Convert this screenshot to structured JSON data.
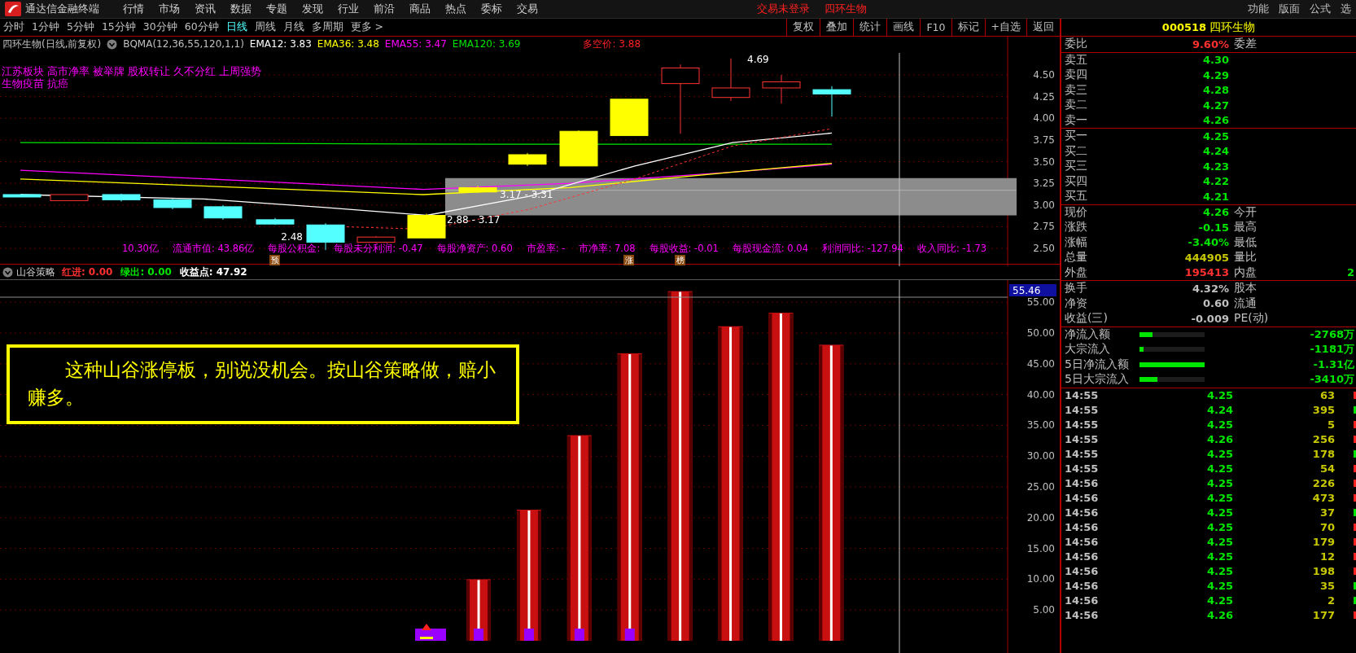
{
  "menu_bar": {
    "app_name": "通达信金融终端",
    "items": [
      "行情",
      "市场",
      "资讯",
      "数据",
      "专题",
      "发现",
      "行业",
      "前沿",
      "商品",
      "热点",
      "委标",
      "交易"
    ],
    "status": [
      "交易未登录",
      "四环生物"
    ],
    "right_items": [
      "功能",
      "版面",
      "公式",
      "选"
    ]
  },
  "period_tabs": [
    {
      "label": "分时",
      "selected": false
    },
    {
      "label": "1分钟",
      "selected": false
    },
    {
      "label": "5分钟",
      "selected": false
    },
    {
      "label": "15分钟",
      "selected": false
    },
    {
      "label": "30分钟",
      "selected": false
    },
    {
      "label": "60分钟",
      "selected": false
    },
    {
      "label": "日线",
      "selected": true
    },
    {
      "label": "周线",
      "selected": false
    },
    {
      "label": "月线",
      "selected": false
    },
    {
      "label": "多周期",
      "selected": false
    },
    {
      "label": "更多 >",
      "selected": false
    }
  ],
  "toolbar_buttons": [
    "复权",
    "叠加",
    "统计",
    "画线",
    "F10",
    "标记",
    "+自选",
    "返回"
  ],
  "price_chart": {
    "title": "四环生物(日线,前复权)",
    "indicator": "BQMA(12,36,55,120,1,1)",
    "lines": [
      {
        "label": "EMA12: 3.83",
        "color": "#ffffff"
      },
      {
        "label": "EMA36: 3.48",
        "color": "#ffff00"
      },
      {
        "label": "EMA55: 3.47",
        "color": "#ff00ff"
      },
      {
        "label": "EMA120: 3.69",
        "color": "#00e600"
      }
    ],
    "bull_bear": "多空价: 3.88",
    "concepts": [
      "江苏板块 高市净率 被举牌 股权转让 久不分红 上周强势",
      "生物疫苗 抗癌"
    ],
    "annotations": [
      "4.69",
      "3.17 - 3.31",
      "2.88 - 3.17",
      "2.48"
    ],
    "price_axis": [
      "4.50",
      "4.25",
      "4.00",
      "3.75",
      "3.50",
      "3.25",
      "3.00",
      "2.75",
      "2.50"
    ],
    "fundamentals": [
      "10.30亿",
      "流通市值: 43.86亿",
      "每股公积金:",
      "每股未分利润: -0.47",
      "每股净资产: 0.60",
      "市盈率: -",
      "市净率: 7.08",
      "每股收益: -0.01",
      "每股现金流: 0.04",
      "利润同比: -127.94",
      "收入同比: -1.73"
    ],
    "badges": [
      "预",
      "涨",
      "榜"
    ]
  },
  "strategy_panel": {
    "title": "山谷策略",
    "readouts": [
      {
        "label": "红进:",
        "value": "0.00",
        "color": "#ff3030"
      },
      {
        "label": "绿出:",
        "value": "0.00",
        "color": "#00e600"
      },
      {
        "label": "收益点:",
        "value": "47.92",
        "color": "#ffffff"
      }
    ],
    "note": "这种山谷涨停板，别说没机会。按山谷策略做，赔小赚多。",
    "max_label": "55.46",
    "chart_data": {
      "type": "bar",
      "grid": true,
      "values": [
        null,
        null,
        null,
        null,
        null,
        null,
        null,
        null,
        null,
        10.0,
        21.3,
        33.4,
        46.7,
        56.8,
        51.1,
        53.3,
        48.1,
        null,
        null,
        null
      ],
      "ylim": [
        0,
        58.6
      ],
      "yticks": [
        {
          "value": 5,
          "label": "5.00"
        },
        {
          "value": 10,
          "label": "10.00"
        },
        {
          "value": 15,
          "label": "15.00"
        },
        {
          "value": 20,
          "label": "20.00"
        },
        {
          "value": 25,
          "label": "25.00"
        },
        {
          "value": 30,
          "label": "30.00"
        },
        {
          "value": 35,
          "label": "35.00"
        },
        {
          "value": 40,
          "label": "40.00"
        },
        {
          "value": 45,
          "label": "45.00"
        },
        {
          "value": 50,
          "label": "50.00"
        },
        {
          "value": 55,
          "label": "55.00"
        }
      ]
    }
  },
  "stock_header": {
    "code": "000518",
    "name": "四环生物"
  },
  "order_ratio": {
    "label": "委比",
    "value": "9.60%",
    "label2": "委差"
  },
  "asks": [
    {
      "label": "卖五",
      "price": "4.30"
    },
    {
      "label": "卖四",
      "price": "4.29"
    },
    {
      "label": "卖三",
      "price": "4.28"
    },
    {
      "label": "卖二",
      "price": "4.27"
    },
    {
      "label": "卖一",
      "price": "4.26"
    }
  ],
  "bids": [
    {
      "label": "买一",
      "price": "4.25"
    },
    {
      "label": "买二",
      "price": "4.24"
    },
    {
      "label": "买三",
      "price": "4.23"
    },
    {
      "label": "买四",
      "price": "4.22"
    },
    {
      "label": "买五",
      "price": "4.21"
    }
  ],
  "quote": [
    {
      "label": "现价",
      "value": "4.26",
      "label2": "今开",
      "color": "#00e600"
    },
    {
      "label": "涨跌",
      "value": "-0.15",
      "label2": "最高",
      "color": "#00e600"
    },
    {
      "label": "涨幅",
      "value": "-3.40%",
      "label2": "最低",
      "color": "#00e600"
    },
    {
      "label": "总量",
      "value": "444905",
      "label2": "量比",
      "color": "#c8c800"
    },
    {
      "label": "外盘",
      "value": "195413",
      "label2": "内盘",
      "value2": "2",
      "color": "#ff3030"
    }
  ],
  "stats": [
    {
      "label": "换手",
      "value": "4.32%",
      "label2": "股本"
    },
    {
      "label": "净资",
      "value": "0.60",
      "label2": "流通"
    },
    {
      "label": "收益(三)",
      "value": "-0.009",
      "label2": "PE(动)"
    }
  ],
  "fund_flows": [
    {
      "label": "净流入额",
      "level": 0.2,
      "value": "-2768万"
    },
    {
      "label": "大宗流入",
      "level": 0.06,
      "value": "-1181万"
    },
    {
      "label": "5日净流入额",
      "level": 1.0,
      "value": "-1.31亿"
    },
    {
      "label": "5日大宗流入",
      "level": 0.27,
      "value": "-3410万"
    }
  ],
  "ticks": [
    {
      "time": "14:55",
      "price": "4.25",
      "volume": "63",
      "color": "#ff2020"
    },
    {
      "time": "14:55",
      "price": "4.24",
      "volume": "395",
      "color": "#00e600"
    },
    {
      "time": "14:55",
      "price": "4.25",
      "volume": "5",
      "color": "#ff2020"
    },
    {
      "time": "14:55",
      "price": "4.26",
      "volume": "256",
      "color": "#ff2020"
    },
    {
      "time": "14:55",
      "price": "4.25",
      "volume": "178",
      "color": "#00e600"
    },
    {
      "time": "14:55",
      "price": "4.25",
      "volume": "54",
      "color": "#ff2020"
    },
    {
      "time": "14:56",
      "price": "4.25",
      "volume": "226",
      "color": "#ff2020"
    },
    {
      "time": "14:56",
      "price": "4.25",
      "volume": "473",
      "color": "#ff2020"
    },
    {
      "time": "14:56",
      "price": "4.25",
      "volume": "37",
      "color": "#00e600"
    },
    {
      "time": "14:56",
      "price": "4.25",
      "volume": "70",
      "color": "#ff2020"
    },
    {
      "time": "14:56",
      "price": "4.25",
      "volume": "179",
      "color": "#ff2020"
    },
    {
      "time": "14:56",
      "price": "4.25",
      "volume": "12",
      "color": "#ff2020"
    },
    {
      "time": "14:56",
      "price": "4.25",
      "volume": "198",
      "color": "#ff2020"
    },
    {
      "time": "14:56",
      "price": "4.25",
      "volume": "35",
      "color": "#00e600"
    },
    {
      "time": "14:56",
      "price": "4.25",
      "volume": "2",
      "color": "#00e600"
    },
    {
      "time": "14:56",
      "price": "4.26",
      "volume": "177",
      "color": "#ff2020"
    }
  ]
}
